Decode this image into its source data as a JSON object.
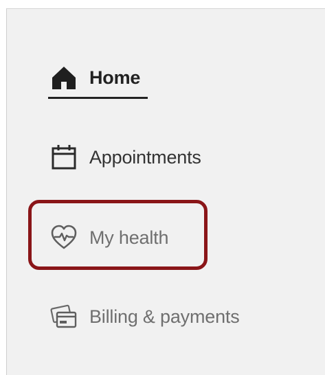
{
  "nav": {
    "items": [
      {
        "label": "Home",
        "icon": "home-icon",
        "active": true
      },
      {
        "label": "Appointments",
        "icon": "calendar-icon",
        "active": false
      },
      {
        "label": "My health",
        "icon": "heart-pulse-icon",
        "active": false,
        "highlighted": true
      },
      {
        "label": "Billing & payments",
        "icon": "credit-card-icon",
        "active": false
      }
    ]
  },
  "colors": {
    "highlight_border": "#8a1518",
    "background": "#f1f1f1",
    "active_text": "#222222",
    "muted_text": "#6f6f6f"
  }
}
